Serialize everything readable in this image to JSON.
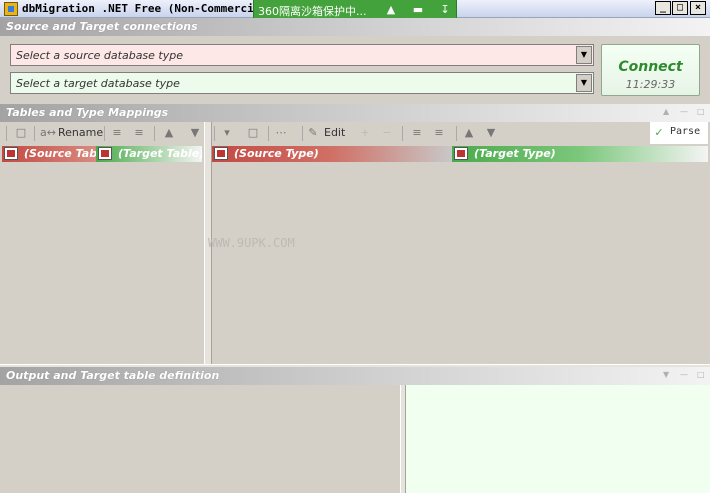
{
  "window": {
    "title": "dbMigration .NET Free (Non-Commercial use)",
    "minimize_label": "_",
    "maximize_label": "□",
    "close_label": "×"
  },
  "sandbox_bar": {
    "text": "360隔离沙箱保护中...",
    "buttons": [
      "rocket-icon",
      "folder-icon",
      "pin-icon"
    ]
  },
  "connections": {
    "section_title": "Source and Target connections",
    "source_select": "Select a source database type",
    "target_select": "Select a target database type",
    "connect_label": "Connect",
    "connect_time": "11:29:33",
    "colors": {
      "source_bg": "#fde7e7",
      "target_bg": "#ecfbec",
      "connect_text": "#2d8a2d"
    }
  },
  "mappings": {
    "section_title": "Tables and Type Mappings",
    "left_toolbar": {
      "rename_label": "Rename"
    },
    "right_toolbar": {
      "edit_label": "Edit",
      "parse_label": "Parse"
    },
    "left_columns": [
      "(Source Table)",
      "(Target Table)"
    ],
    "right_columns": [
      "(Source Type)",
      "(Target Type)"
    ],
    "colors": {
      "source_header": "#c24a43",
      "target_header": "#4aaa4a"
    }
  },
  "watermark": "WWW.9UPK.COM",
  "output": {
    "section_title": "Output and Target table definition",
    "colors": {
      "definition_bg": "#f0fff0"
    }
  }
}
